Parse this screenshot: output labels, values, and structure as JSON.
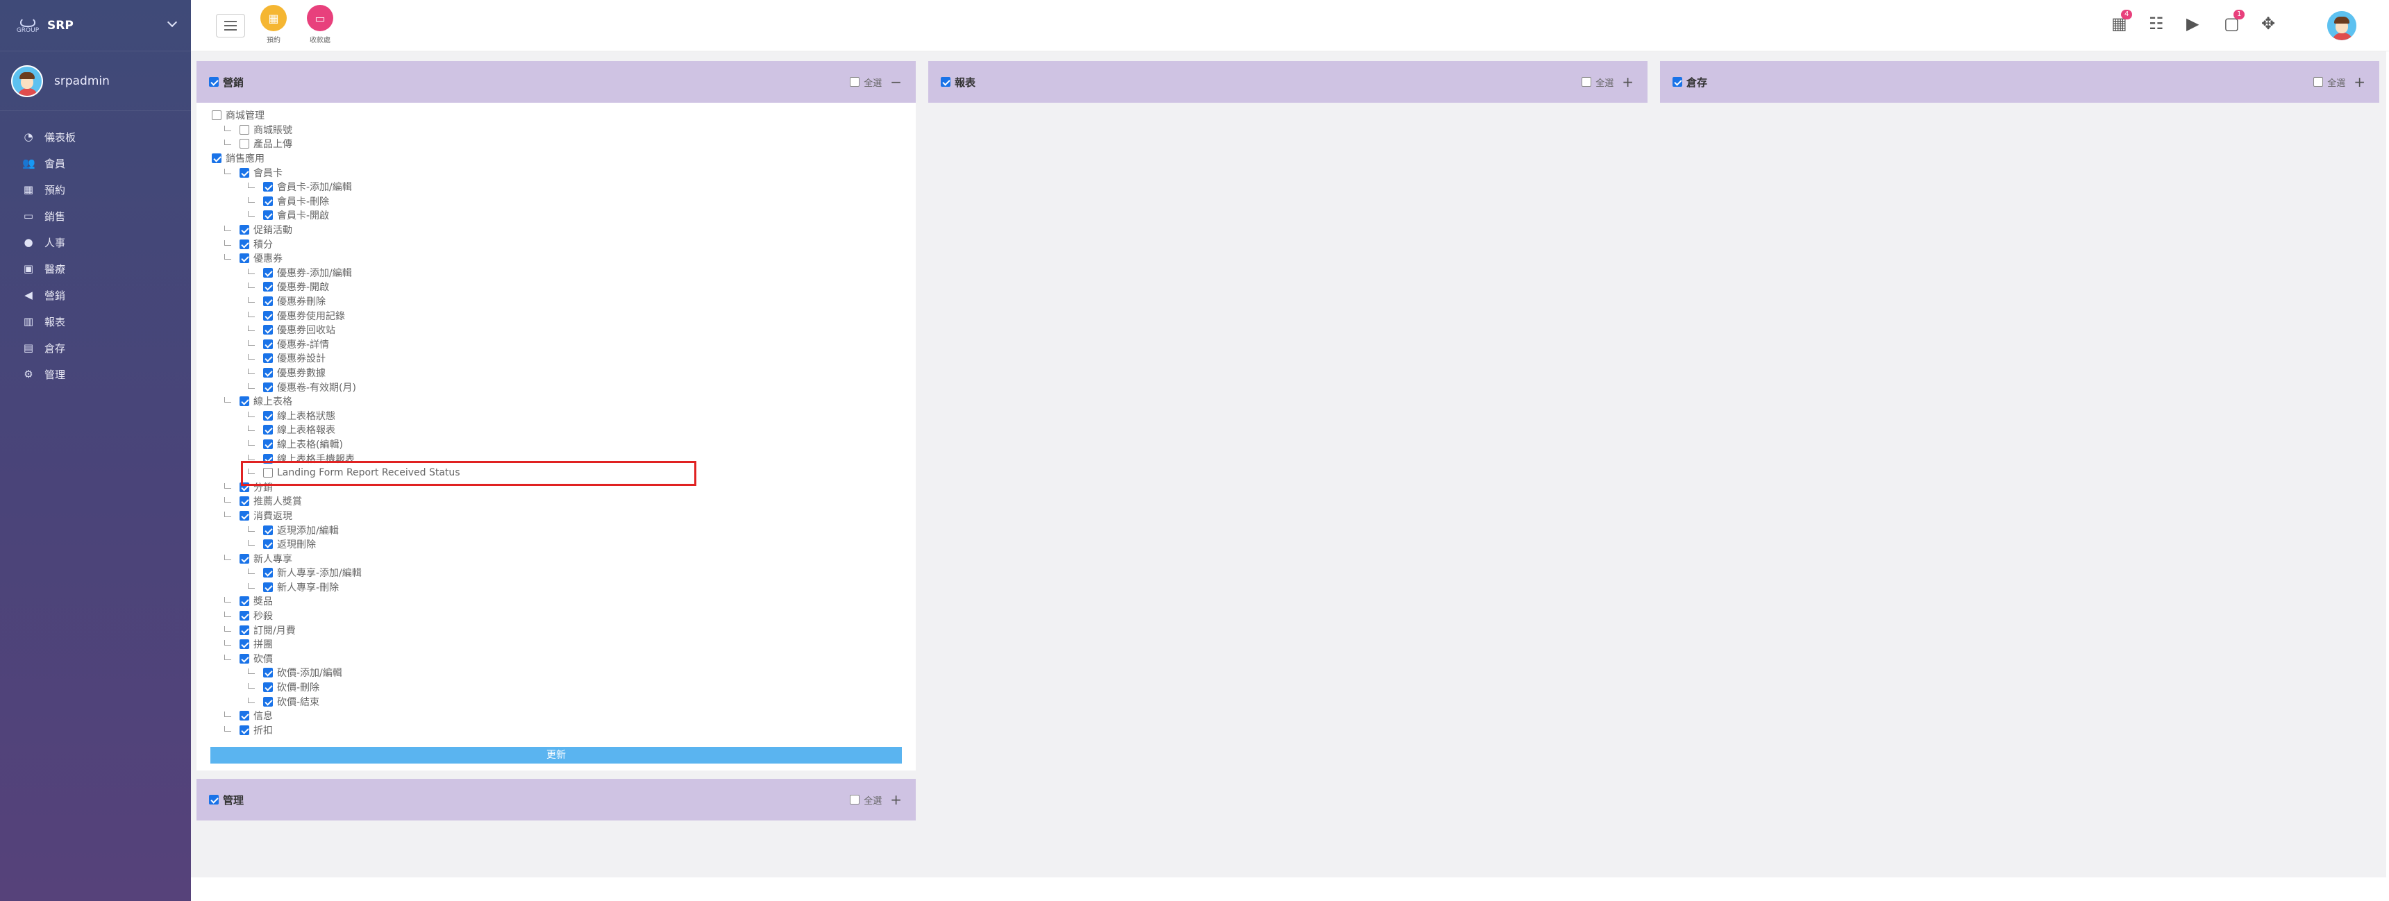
{
  "brand": {
    "title": "SRP",
    "logo_text": "srp",
    "logo_sub": "GROUP"
  },
  "user": {
    "name": "srpadmin"
  },
  "nav": [
    {
      "label": "儀表板",
      "icon": "◔"
    },
    {
      "label": "會員",
      "icon": "👥"
    },
    {
      "label": "預約",
      "icon": "▦"
    },
    {
      "label": "銷售",
      "icon": "▭"
    },
    {
      "label": "人事",
      "icon": "●"
    },
    {
      "label": "醫療",
      "icon": "▣"
    },
    {
      "label": "營銷",
      "icon": "◀"
    },
    {
      "label": "報表",
      "icon": "▥"
    },
    {
      "label": "倉存",
      "icon": "▤"
    },
    {
      "label": "管理",
      "icon": "⚙"
    }
  ],
  "topbar": {
    "quick": [
      {
        "label": "預約",
        "color": "#f5b632",
        "icon": "▦"
      },
      {
        "label": "收款處",
        "color": "#e8407c",
        "icon": "▭"
      }
    ],
    "badges": {
      "notifications": "4",
      "messages": "1"
    }
  },
  "colors": {
    "accent": "#1a73e8",
    "panel_head": "#cfc3e3",
    "update_button": "#5ab4f0",
    "highlight": "#e02222"
  },
  "panels": {
    "marketing": {
      "title": "營銷",
      "select_all": "全選",
      "toggle": "−",
      "update": "更新"
    },
    "reports": {
      "title": "報表",
      "select_all": "全選",
      "toggle": "+"
    },
    "inventory": {
      "title": "倉存",
      "select_all": "全選",
      "toggle": "+"
    },
    "admin": {
      "title": "管理",
      "select_all": "全選",
      "toggle": "+"
    }
  },
  "tree": [
    {
      "level": 0,
      "label": "商城管理",
      "checked": false
    },
    {
      "level": 1,
      "label": "商城賬號",
      "checked": false
    },
    {
      "level": 1,
      "label": "產品上傳",
      "checked": false
    },
    {
      "level": 0,
      "label": "銷售應用",
      "checked": true
    },
    {
      "level": 1,
      "label": "會員卡",
      "checked": true
    },
    {
      "level": 2,
      "label": "會員卡-添加/編輯",
      "checked": true
    },
    {
      "level": 2,
      "label": "會員卡-刪除",
      "checked": true
    },
    {
      "level": 2,
      "label": "會員卡-開啟",
      "checked": true
    },
    {
      "level": 1,
      "label": "促銷活動",
      "checked": true
    },
    {
      "level": 1,
      "label": "積分",
      "checked": true
    },
    {
      "level": 1,
      "label": "優惠券",
      "checked": true
    },
    {
      "level": 2,
      "label": "優惠券-添加/編輯",
      "checked": true
    },
    {
      "level": 2,
      "label": "優惠券-開啟",
      "checked": true
    },
    {
      "level": 2,
      "label": "優惠券刪除",
      "checked": true
    },
    {
      "level": 2,
      "label": "優惠券使用記錄",
      "checked": true
    },
    {
      "level": 2,
      "label": "優惠券回收站",
      "checked": true
    },
    {
      "level": 2,
      "label": "優惠券-詳情",
      "checked": true
    },
    {
      "level": 2,
      "label": "優惠券設計",
      "checked": true
    },
    {
      "level": 2,
      "label": "優惠券數據",
      "checked": true
    },
    {
      "level": 2,
      "label": "優惠卷-有效期(月)",
      "checked": true
    },
    {
      "level": 1,
      "label": "線上表格",
      "checked": true
    },
    {
      "level": 2,
      "label": "線上表格狀態",
      "checked": true
    },
    {
      "level": 2,
      "label": "線上表格報表",
      "checked": true
    },
    {
      "level": 2,
      "label": "線上表格(編輯)",
      "checked": true
    },
    {
      "level": 2,
      "label": "線上表格手機報表",
      "checked": true
    },
    {
      "level": 2,
      "label": "Landing Form Report Received Status",
      "checked": false
    },
    {
      "level": 1,
      "label": "分銷",
      "checked": true
    },
    {
      "level": 1,
      "label": "推薦人獎賞",
      "checked": true
    },
    {
      "level": 1,
      "label": "消費返現",
      "checked": true
    },
    {
      "level": 2,
      "label": "返現添加/編輯",
      "checked": true
    },
    {
      "level": 2,
      "label": "返現刪除",
      "checked": true
    },
    {
      "level": 1,
      "label": "新人專享",
      "checked": true
    },
    {
      "level": 2,
      "label": "新人專享-添加/編輯",
      "checked": true
    },
    {
      "level": 2,
      "label": "新人專享-刪除",
      "checked": true
    },
    {
      "level": 1,
      "label": "獎品",
      "checked": true
    },
    {
      "level": 1,
      "label": "秒殺",
      "checked": true
    },
    {
      "level": 1,
      "label": "訂閱/月費",
      "checked": true
    },
    {
      "level": 1,
      "label": "拼團",
      "checked": true
    },
    {
      "level": 1,
      "label": "砍價",
      "checked": true
    },
    {
      "level": 2,
      "label": "砍價-添加/編輯",
      "checked": true
    },
    {
      "level": 2,
      "label": "砍價-刪除",
      "checked": true
    },
    {
      "level": 2,
      "label": "砍價-結束",
      "checked": true
    },
    {
      "level": 1,
      "label": "信息",
      "checked": true
    },
    {
      "level": 1,
      "label": "折扣",
      "checked": true
    }
  ]
}
